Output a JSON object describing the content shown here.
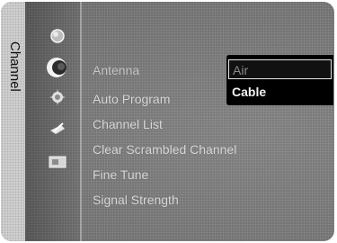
{
  "side_tab": {
    "label": "Channel"
  },
  "icons": [
    {
      "name": "picture-icon"
    },
    {
      "name": "sound-icon"
    },
    {
      "name": "channel-icon"
    },
    {
      "name": "setup-icon"
    },
    {
      "name": "input-icon"
    }
  ],
  "menu": {
    "items": [
      {
        "label": "Antenna"
      },
      {
        "label": "Auto Program"
      },
      {
        "label": "Channel List"
      },
      {
        "label": "Clear Scrambled Channel"
      },
      {
        "label": "Fine Tune"
      },
      {
        "label": "Signal Strength"
      }
    ]
  },
  "dropdown": {
    "options": [
      {
        "label": "Air",
        "selected": true
      },
      {
        "label": "Cable",
        "selected": false
      }
    ]
  }
}
